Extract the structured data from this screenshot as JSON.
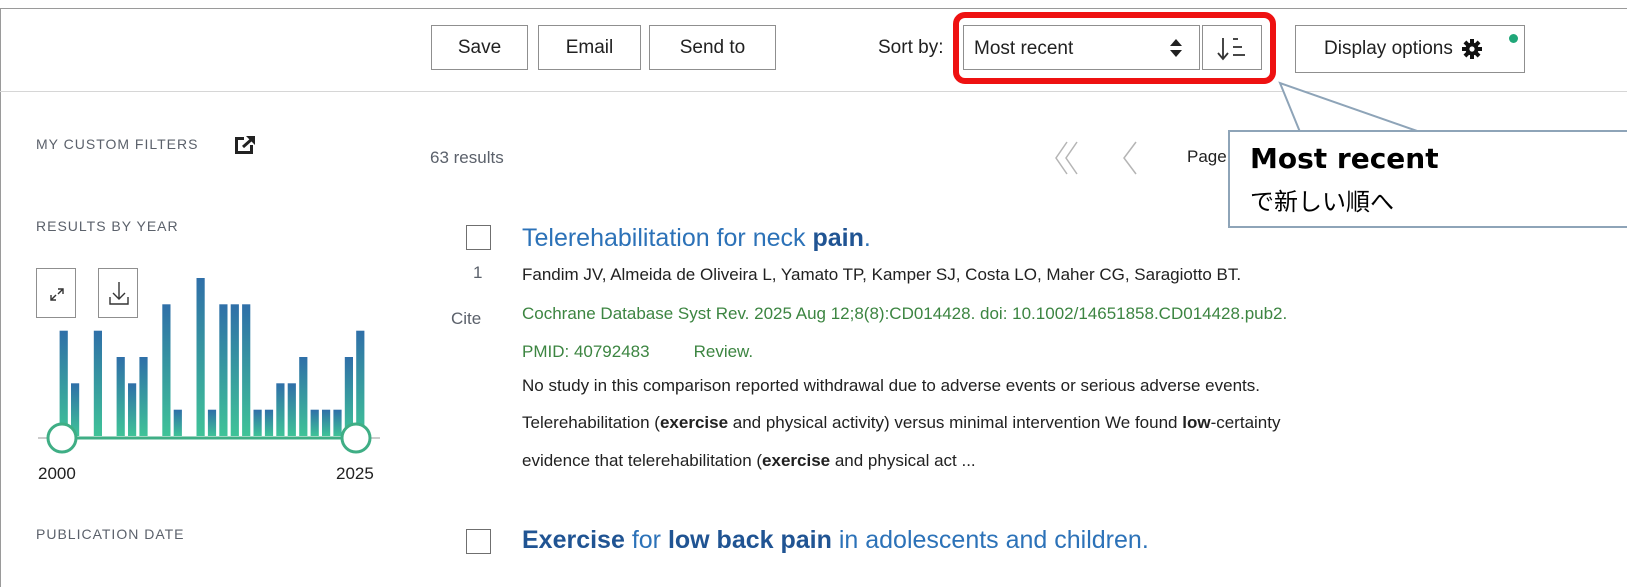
{
  "toolbar": {
    "save_label": "Save",
    "email_label": "Email",
    "send_to_label": "Send to",
    "sort_by_label": "Sort by:",
    "sort_value": "Most recent",
    "display_options_label": "Display options"
  },
  "callout": {
    "title": "Most recent",
    "subtitle": "で新しい順へ"
  },
  "sidebar": {
    "custom_filters": "MY CUSTOM FILTERS",
    "results_by_year": "RESULTS BY YEAR",
    "year_start": "2000",
    "year_end": "2025",
    "publication_date": "PUBLICATION DATE"
  },
  "chart_data": {
    "type": "bar",
    "x_range": [
      "2000",
      "2025"
    ],
    "values": [
      4,
      2,
      0,
      4,
      0,
      3,
      2,
      3,
      0,
      5,
      1,
      0,
      6,
      1,
      5,
      5,
      5,
      1,
      1,
      2,
      2,
      3,
      1,
      1,
      1,
      3,
      4
    ]
  },
  "results": {
    "count": "63 results",
    "page_label": "Page"
  },
  "article1": {
    "number": "1",
    "cite": "Cite",
    "title_a": "Telerehabilitation for neck ",
    "title_b": "pain",
    "title_c": ".",
    "authors": "Fandim JV, Almeida de Oliveira L, Yamato TP, Kamper SJ, Costa LO, Maher CG, Saragiotto BT.",
    "journal": "Cochrane Database Syst Rev. 2025 Aug 12;8(8):CD014428. doi: 10.1002/14651858.CD014428.pub2.",
    "pmid": "PMID: 40792483",
    "type": "Review.",
    "snippet1": "No study in this comparison reported withdrawal due to adverse events or serious adverse events.",
    "snippet2_a": "Telerehabilitation (",
    "snippet2_b": "exercise",
    "snippet2_c": " and physical activity) versus minimal intervention We found ",
    "snippet2_d": "low",
    "snippet2_e": "-certainty",
    "snippet3_a": "evidence that telerehabilitation (",
    "snippet3_b": "exercise",
    "snippet3_c": " and physical act ..."
  },
  "article2": {
    "title_a": "Exercise",
    "title_b": " for ",
    "title_c": "low back pain",
    "title_d": " in adolescents and children."
  },
  "colors": {
    "highlight": "#ee1111",
    "link": "#2c72b8",
    "journal": "#3c8541",
    "bar_top": "#2f6fa8",
    "bar_bottom": "#3fc398"
  }
}
